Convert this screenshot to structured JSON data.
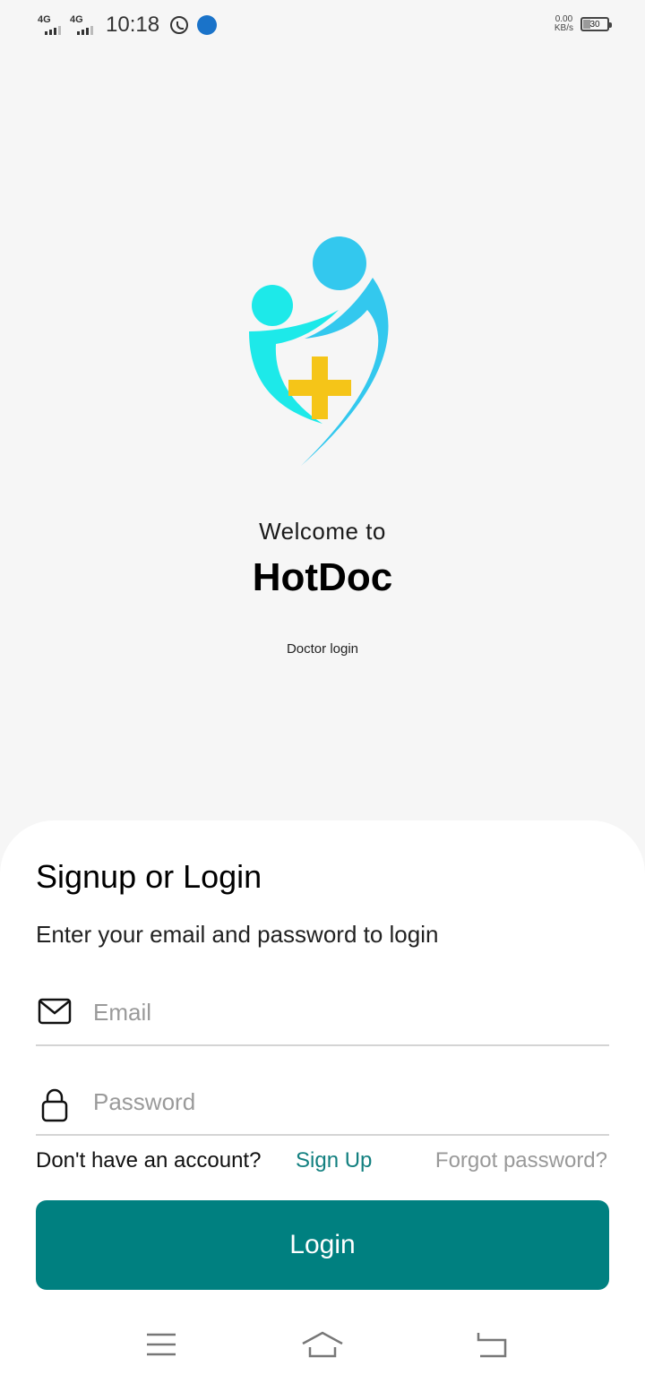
{
  "status_bar": {
    "network_1": "4G",
    "network_2": "4G",
    "time": "10:18",
    "speed_value": "0.00",
    "speed_unit": "KB/s",
    "battery_level": "30",
    "battery_fraction": 0.3,
    "icons": [
      "signal-icon",
      "whatsapp-icon",
      "app-notification-icon",
      "battery-icon"
    ]
  },
  "hero": {
    "welcome": "Welcome to",
    "app_name": "HotDoc",
    "subtitle": "Doctor login",
    "logo_colors": {
      "cyan": "#1de9e9",
      "blue": "#33c8ee",
      "cross": "#f5c518"
    }
  },
  "form": {
    "title": "Signup or Login",
    "subtitle": "Enter your email and password to login",
    "email_placeholder": "Email",
    "email_value": "",
    "password_placeholder": "Password",
    "password_value": "",
    "no_account": "Don't have an account?",
    "sign_up": "Sign Up",
    "forgot_password": "Forgot password?",
    "login_button": "Login"
  },
  "colors": {
    "accent": "#008080",
    "link": "#138080",
    "background": "#f6f6f6",
    "sheet": "#ffffff"
  },
  "nav_bar": {
    "icons": [
      "menu-icon",
      "home-icon",
      "back-icon"
    ]
  }
}
